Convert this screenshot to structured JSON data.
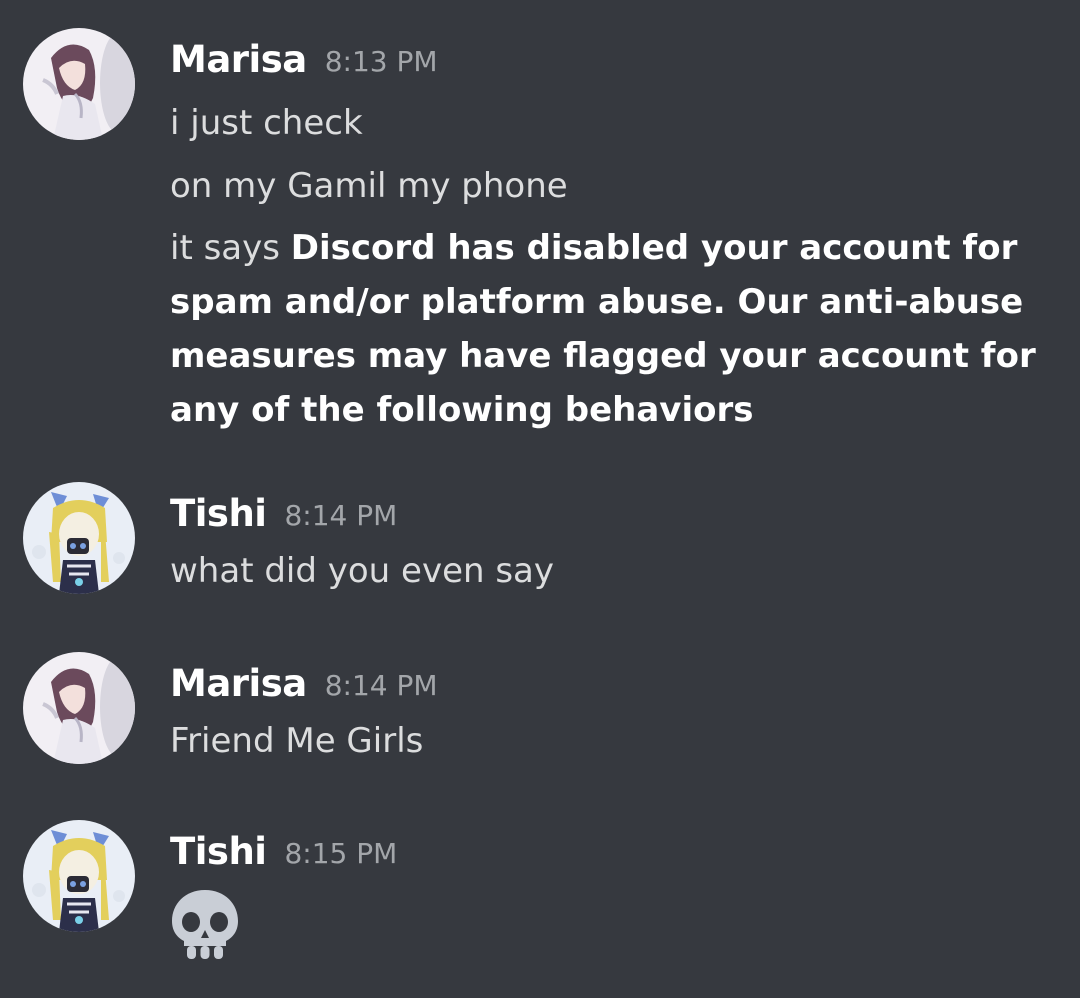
{
  "messages": [
    {
      "username": "Marisa",
      "timestamp": "8:13 PM",
      "avatar": "marisa-avatar",
      "lines": [
        "i just check",
        "on my Gamil my phone"
      ],
      "rich_line": {
        "prefix": "it says ",
        "bold": "Discord has disabled your account for spam and/or platform abuse. Our anti-abuse measures may have flagged your account for any of the following behaviors"
      }
    },
    {
      "username": "Tishi",
      "timestamp": "8:14 PM",
      "avatar": "tishi-avatar",
      "lines": [
        "what did you even say"
      ]
    },
    {
      "username": "Marisa",
      "timestamp": "8:14 PM",
      "avatar": "marisa-avatar",
      "lines": [
        "Friend Me Girls"
      ]
    },
    {
      "username": "Tishi",
      "timestamp": "8:15 PM",
      "avatar": "tishi-avatar",
      "emoji": "skull-emoji"
    }
  ],
  "colors": {
    "background": "#36393f",
    "username": "#ffffff",
    "timestamp": "#a3a6aa",
    "text": "#dcddde"
  }
}
